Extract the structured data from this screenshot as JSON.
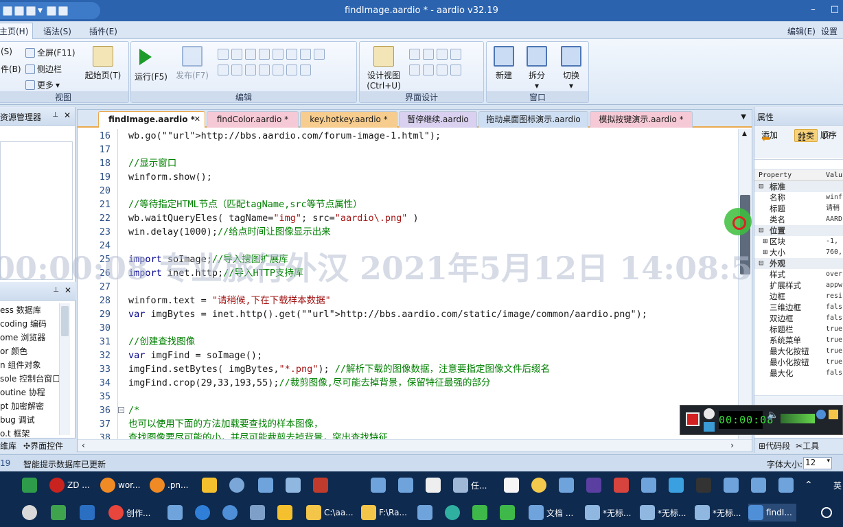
{
  "window": {
    "title": "findImage.aardio * - aardio v32.19",
    "min": "–",
    "max": "□"
  },
  "ribbon_tabs": [
    {
      "label": "主页(H)",
      "active": true
    },
    {
      "label": "语法(S)"
    },
    {
      "label": "插件(E)"
    }
  ],
  "ribbon_right": {
    "edit": "编辑(E)",
    "settings": "设置"
  },
  "ribbon": {
    "view_group": {
      "name": "视图",
      "items": [
        "(S)",
        "件(B)",
        "全屏(F11)",
        "侧边栏",
        "更多"
      ],
      "start_page": "起始页(T)"
    },
    "run": "运行(F5)",
    "publish": "发布(F7)",
    "edit_group": "编辑",
    "design_view": "设计视图",
    "design_view_key": "(Ctrl+U)",
    "ui_group": "界面设计",
    "new": "新建",
    "split": "拆分",
    "switch": "切换",
    "window_group": "窗口"
  },
  "left_panel": {
    "title": "资源管理器",
    "libs": [
      "ess 数据库",
      "coding 编码",
      "ome 浏览器",
      "or 颜色",
      "n 组件对象",
      "sole 控制台窗口",
      "outine 协程",
      "pt 加密解密",
      "bug 调试",
      "o.t 框架"
    ],
    "bottom_tabs": [
      "维库",
      "界面控件"
    ]
  },
  "doc_tabs": [
    {
      "label": "findImage.aardio *",
      "active": true
    },
    {
      "label": "findColor.aardio *"
    },
    {
      "label": "key.hotkey.aardio *"
    },
    {
      "label": "暂停继续.aardio"
    },
    {
      "label": "拖动桌面图标演示.aardio"
    },
    {
      "label": "模拟按键演示.aardio *"
    }
  ],
  "code_lines": [
    {
      "n": "16",
      "t": "wb.go(\"http://bbs.aardio.com/forum-image-1.html\");"
    },
    {
      "n": "17",
      "t": ""
    },
    {
      "n": "18",
      "t": "//显示窗口"
    },
    {
      "n": "19",
      "t": "winform.show();"
    },
    {
      "n": "20",
      "t": ""
    },
    {
      "n": "21",
      "t": "//等待指定HTML节点（匹配tagName,src等节点属性）"
    },
    {
      "n": "22",
      "t": "wb.waitQueryEles( tagName=\"img\"; src=\"aardio\\.png\" )"
    },
    {
      "n": "23",
      "t": "win.delay(1000);//给点时间让图像显示出来"
    },
    {
      "n": "24",
      "t": ""
    },
    {
      "n": "25",
      "t": "import soImage;//导入搜图扩展库"
    },
    {
      "n": "26",
      "t": "import inet.http;//导入HTTP支持库"
    },
    {
      "n": "27",
      "t": ""
    },
    {
      "n": "28",
      "t": "winform.text = \"请稍候,下在下载样本数据\""
    },
    {
      "n": "29",
      "t": "var imgBytes = inet.http().get(\"http://bbs.aardio.com/static/image/common/aardio.png\");"
    },
    {
      "n": "30",
      "t": ""
    },
    {
      "n": "31",
      "t": "//创建查找图像"
    },
    {
      "n": "32",
      "t": "var imgFind = soImage();"
    },
    {
      "n": "33",
      "t": "imgFind.setBytes( imgBytes,\"*.png\"); //解析下载的图像数据，注意要指定图像文件后缀名"
    },
    {
      "n": "34",
      "t": "imgFind.crop(29,33,193,55);//裁剪图像,尽可能去掉背景，保留特征最强的部分"
    },
    {
      "n": "35",
      "t": ""
    },
    {
      "n": "36",
      "t": "/*"
    },
    {
      "n": "37",
      "t": "也可以使用下面的方法加载要查找的样本图像，"
    },
    {
      "n": "38",
      "t": "查找图像要尽可能的小，并尽可能裁剪去掉背景，突出查找特征"
    }
  ],
  "right_panel": {
    "title": "属性",
    "tools": [
      "添加",
      "分类",
      "顺序"
    ],
    "grid_header": [
      "Property",
      "Valu"
    ],
    "rows": [
      {
        "cat": "标准"
      },
      {
        "k": "名称",
        "v": "winf"
      },
      {
        "k": "标题",
        "v": "请稍"
      },
      {
        "k": "类名",
        "v": "AARD"
      },
      {
        "cat": "位置"
      },
      {
        "k": "区块",
        "v": "-1,",
        "exp": "+"
      },
      {
        "k": "大小",
        "v": "760,",
        "exp": "+"
      },
      {
        "cat": "外观"
      },
      {
        "k": "样式",
        "v": "over"
      },
      {
        "k": "扩展样式",
        "v": "appw"
      },
      {
        "k": "边框",
        "v": "resi"
      },
      {
        "k": "三维边框",
        "v": "fals"
      },
      {
        "k": "双边框",
        "v": "fals"
      },
      {
        "k": "标题栏",
        "v": "true"
      },
      {
        "k": "系统菜单",
        "v": "true"
      },
      {
        "k": "最大化按钮",
        "v": "true"
      },
      {
        "k": "最小化按钮",
        "v": "true"
      },
      {
        "k": "最大化",
        "v": "fals"
      }
    ],
    "bottom_tabs": [
      "代码段",
      "工具"
    ]
  },
  "status": {
    "line": "19",
    "message": "智能提示数据库已更新",
    "font_size_label": "字体大小:",
    "font_size": "12"
  },
  "recorder": {
    "time": "00:00:08"
  },
  "watermark": "00:00:08 专业旅行外汉 2021年5月12日 14:08:5",
  "taskbar_row1": [
    "ZD ...",
    "wor...",
    ".pn...",
    "任..."
  ],
  "taskbar_row2": [
    "创作...",
    "C:\\aa...",
    "F:\\Ra...",
    "文档 ...",
    "*无标...",
    "*无标...",
    "*无标...",
    "findI..."
  ],
  "ime": "英",
  "colors": {
    "titlebar": "#2b63ae",
    "accent_tab": "#e9a84c",
    "taskbar": "#0e2a4f"
  }
}
